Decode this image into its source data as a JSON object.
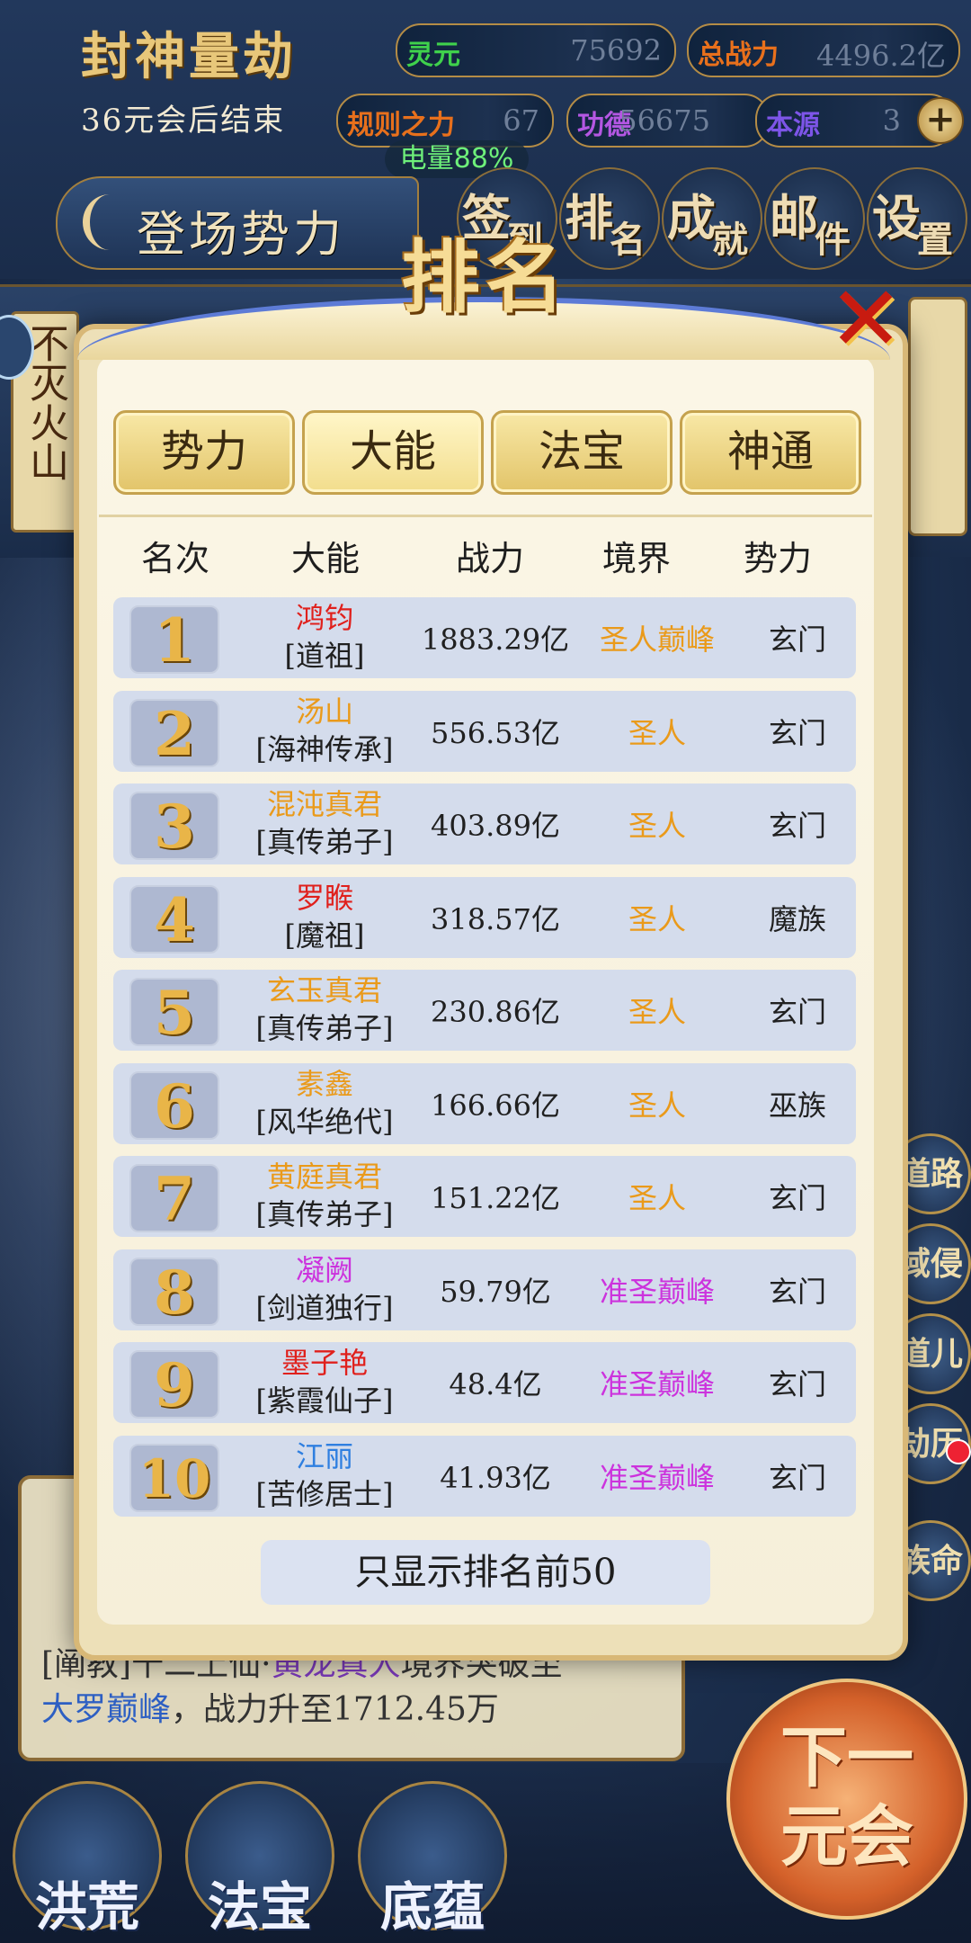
{
  "hud": {
    "game_title": "封神量劫",
    "countdown": "36元会后结束",
    "stats": {
      "lingyuan": {
        "label": "灵元",
        "value": "75692",
        "color": "#3fd14c"
      },
      "zongzhanli": {
        "label": "总战力",
        "value": "4496.2亿",
        "color": "#e8701c"
      },
      "guize": {
        "label": "规则之力",
        "value": "67",
        "color": "#e8701c"
      },
      "gongde": {
        "label": "功德",
        "value": "56675",
        "color": "#b457e3"
      },
      "benyuan": {
        "label": "本源",
        "value": "3",
        "color": "#7d55e8"
      }
    },
    "plus": "+",
    "battery": "电量88%",
    "faction_button": "登场势力",
    "nav": [
      {
        "a": "签",
        "b": "到"
      },
      {
        "a": "排",
        "b": "名"
      },
      {
        "a": "成",
        "b": "就"
      },
      {
        "a": "邮",
        "b": "件"
      },
      {
        "a": "设",
        "b": "置"
      }
    ]
  },
  "background": {
    "volcano_label": "不灭火山",
    "side_buttons": [
      "道路",
      "域侵",
      "道儿",
      "劫历",
      "族命"
    ],
    "log_last": {
      "prefix": "[阐教]十二上仙·",
      "name": "黄龙真人",
      "middle": "境界突破至",
      "realm": "大罗巅峰",
      "suffix": "，战力升至1712.45万"
    },
    "bottom": [
      "洪荒",
      "法宝",
      "底蕴"
    ],
    "next_era": [
      "下一",
      "元会"
    ]
  },
  "modal": {
    "title": "排名",
    "close": "✕",
    "tabs": [
      {
        "label": "势力",
        "active": false
      },
      {
        "label": "大能",
        "active": true
      },
      {
        "label": "法宝",
        "active": false
      },
      {
        "label": "神通",
        "active": false
      }
    ],
    "headers": {
      "rank": "名次",
      "name": "大能",
      "power": "战力",
      "realm": "境界",
      "faction": "势力"
    },
    "rows": [
      {
        "rank": "1",
        "name": "鸿钧",
        "name_color": "#e0201c",
        "title": "[道祖]",
        "power": "1883.29亿",
        "realm": "圣人巅峰",
        "realm_color": "#ea9a1a",
        "faction": "玄门"
      },
      {
        "rank": "2",
        "name": "汤山",
        "name_color": "#ea9a1a",
        "title": "[海神传承]",
        "power": "556.53亿",
        "realm": "圣人",
        "realm_color": "#ea9a1a",
        "faction": "玄门"
      },
      {
        "rank": "3",
        "name": "混沌真君",
        "name_color": "#ea9a1a",
        "title": "[真传弟子]",
        "power": "403.89亿",
        "realm": "圣人",
        "realm_color": "#ea9a1a",
        "faction": "玄门"
      },
      {
        "rank": "4",
        "name": "罗睺",
        "name_color": "#e0201c",
        "title": "[魔祖]",
        "power": "318.57亿",
        "realm": "圣人",
        "realm_color": "#ea9a1a",
        "faction": "魔族"
      },
      {
        "rank": "5",
        "name": "玄玉真君",
        "name_color": "#ea9a1a",
        "title": "[真传弟子]",
        "power": "230.86亿",
        "realm": "圣人",
        "realm_color": "#ea9a1a",
        "faction": "玄门"
      },
      {
        "rank": "6",
        "name": "素鑫",
        "name_color": "#ea9a1a",
        "title": "[风华绝代]",
        "power": "166.66亿",
        "realm": "圣人",
        "realm_color": "#ea9a1a",
        "faction": "巫族"
      },
      {
        "rank": "7",
        "name": "黄庭真君",
        "name_color": "#ea9a1a",
        "title": "[真传弟子]",
        "power": "151.22亿",
        "realm": "圣人",
        "realm_color": "#ea9a1a",
        "faction": "玄门"
      },
      {
        "rank": "8",
        "name": "凝阙",
        "name_color": "#cc33dd",
        "title": "[剑道独行]",
        "power": "59.79亿",
        "realm": "准圣巅峰",
        "realm_color": "#cc33dd",
        "faction": "玄门"
      },
      {
        "rank": "9",
        "name": "墨子艳",
        "name_color": "#e0201c",
        "title": "[紫霞仙子]",
        "power": "48.4亿",
        "realm": "准圣巅峰",
        "realm_color": "#cc33dd",
        "faction": "玄门"
      },
      {
        "rank": "10",
        "name": "江丽",
        "name_color": "#2f7fe0",
        "title": "[苦修居士]",
        "power": "41.93亿",
        "realm": "准圣巅峰",
        "realm_color": "#cc33dd",
        "faction": "玄门"
      }
    ],
    "footer_note": "只显示排名前50"
  }
}
